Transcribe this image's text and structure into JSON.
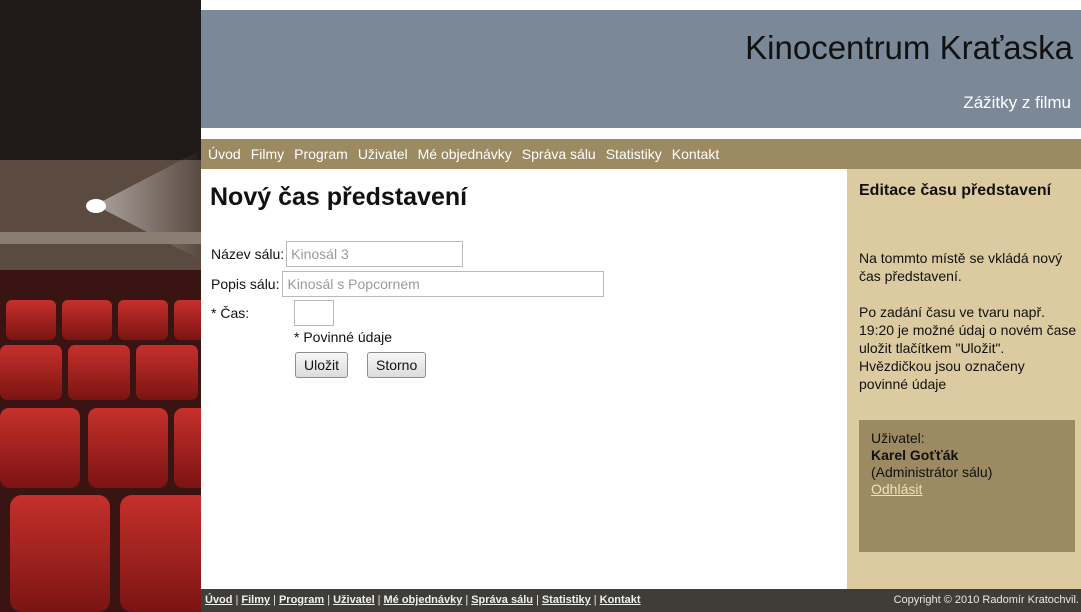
{
  "header": {
    "title": "Kinocentrum Kraťaska",
    "subtitle": "Zážitky z filmu"
  },
  "nav": {
    "items": [
      "Úvod",
      "Filmy",
      "Program",
      "Uživatel",
      "Mé objednávky",
      "Správa sálu",
      "Statistiky",
      "Kontakt"
    ]
  },
  "main": {
    "heading": "Nový čas představení",
    "form": {
      "hall_name_label": "Název sálu:",
      "hall_name_value": "Kinosál 3",
      "hall_desc_label": "Popis sálu:",
      "hall_desc_value": "Kinosál s Popcornem",
      "time_label": "* Čas:",
      "time_value": "",
      "required_note": "* Povinné údaje",
      "save_label": "Uložit",
      "cancel_label": "Storno"
    }
  },
  "sidebar": {
    "heading": "Editace času představení",
    "paragraph1": "Na tommto místě se vkládá nový čas představení.",
    "paragraph2": "Po zadání času ve tvaru např. 19:20 je možné údaj o novém čase uložit tlačítkem \"Uložit\". Hvězdičkou jsou označeny povinné údaje",
    "user": {
      "label": "Uživatel:",
      "name": "Karel Goťťák",
      "role": "(Administrátor sálu)",
      "logout": "Odhlásit"
    }
  },
  "footer": {
    "links": [
      "Úvod",
      "Filmy",
      "Program",
      "Uživatel",
      "Mé objednávky",
      "Správa sálu",
      "Statistiky",
      "Kontakt"
    ],
    "copyright": "Copyright © 2010 Radomír Kratochvil."
  },
  "colors": {
    "header_bg": "#7a8898",
    "nav_bg": "#9b8a62",
    "sidebar_bg": "#dccaa0",
    "footer_bg": "#3f3d37"
  }
}
